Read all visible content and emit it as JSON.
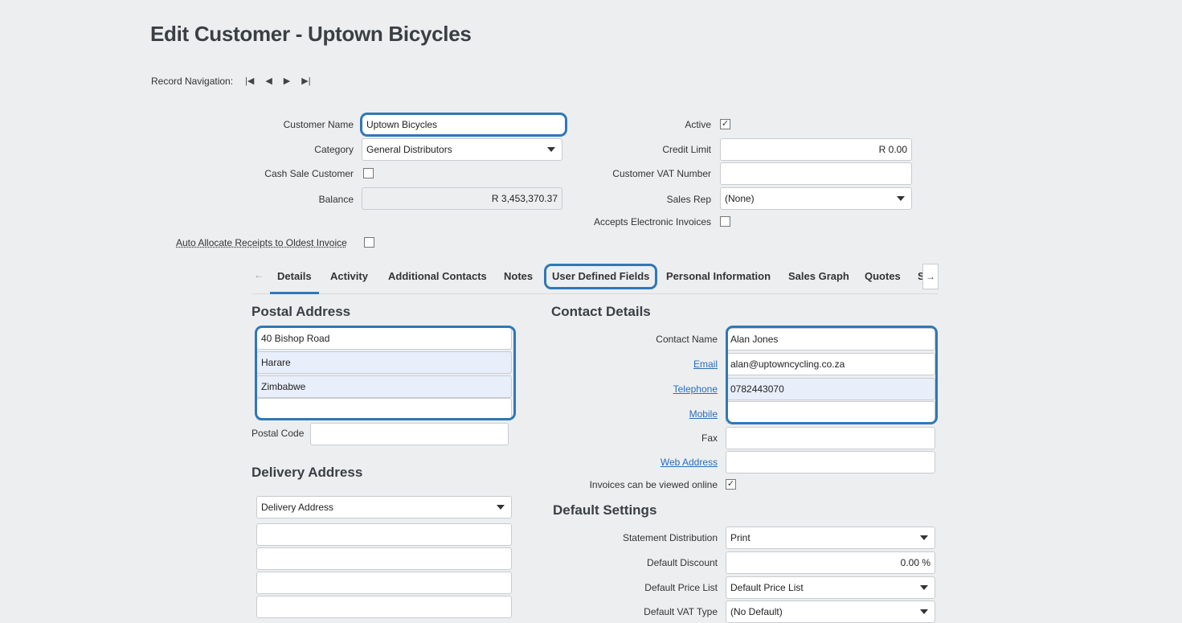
{
  "title": "Edit Customer - Uptown Bicycles",
  "record_navigation": {
    "label": "Record Navigation:",
    "first": "|◀",
    "prev": "◀",
    "next": "▶",
    "last": "▶|"
  },
  "customer": {
    "name_label": "Customer Name",
    "name_value": "Uptown Bicycles",
    "category_label": "Category",
    "category_value": "General Distributors",
    "cash_sale_label": "Cash Sale Customer",
    "cash_sale_checked": false,
    "balance_label": "Balance",
    "balance_value": "R 3,453,370.37",
    "active_label": "Active",
    "active_checked": true,
    "credit_limit_label": "Credit Limit",
    "credit_limit_value": "R 0.00",
    "vat_label": "Customer VAT Number",
    "vat_value": "",
    "sales_rep_label": "Sales Rep",
    "sales_rep_value": "(None)",
    "electronic_invoices_label": "Accepts Electronic Invoices",
    "electronic_invoices_checked": false,
    "auto_allocate_label": "Auto Allocate Receipts to Oldest Invoice",
    "auto_allocate_checked": false
  },
  "tabs": [
    {
      "label": "Details",
      "active": true
    },
    {
      "label": "Activity"
    },
    {
      "label": "Additional Contacts"
    },
    {
      "label": "Notes"
    },
    {
      "label": "User Defined Fields"
    },
    {
      "label": "Personal Information"
    },
    {
      "label": "Sales Graph"
    },
    {
      "label": "Quotes"
    },
    {
      "label": "S"
    }
  ],
  "tab_scroll": {
    "left": "←",
    "right": "→"
  },
  "postal_address": {
    "heading": "Postal Address",
    "lines": [
      "40 Bishop Road",
      "Harare",
      "Zimbabwe",
      ""
    ],
    "postal_code_label": "Postal Code",
    "postal_code_value": ""
  },
  "delivery_address": {
    "heading": "Delivery Address",
    "select_value": "Delivery Address",
    "lines": [
      "",
      "",
      "",
      ""
    ]
  },
  "contact_details": {
    "heading": "Contact Details",
    "contact_name_label": "Contact Name",
    "contact_name_value": "Alan Jones",
    "email_label": "Email",
    "email_value": "alan@uptowncycling.co.za",
    "telephone_label": "Telephone",
    "telephone_value": "0782443070",
    "mobile_label": "Mobile",
    "mobile_value": "",
    "fax_label": "Fax",
    "fax_value": "",
    "web_label": "Web Address",
    "web_value": "",
    "view_online_label": "Invoices can be viewed online",
    "view_online_checked": true
  },
  "default_settings": {
    "heading": "Default Settings",
    "statement_label": "Statement Distribution",
    "statement_value": "Print",
    "discount_label": "Default Discount",
    "discount_value": "0.00 %",
    "price_list_label": "Default Price List",
    "price_list_value": "Default Price List",
    "vat_type_label": "Default VAT Type",
    "vat_type_value": "(No Default)"
  },
  "icons": {
    "checked": "✓"
  },
  "colors": {
    "highlight": "#2f78b7",
    "link": "#2a6ebb",
    "background": "#eceef0"
  }
}
